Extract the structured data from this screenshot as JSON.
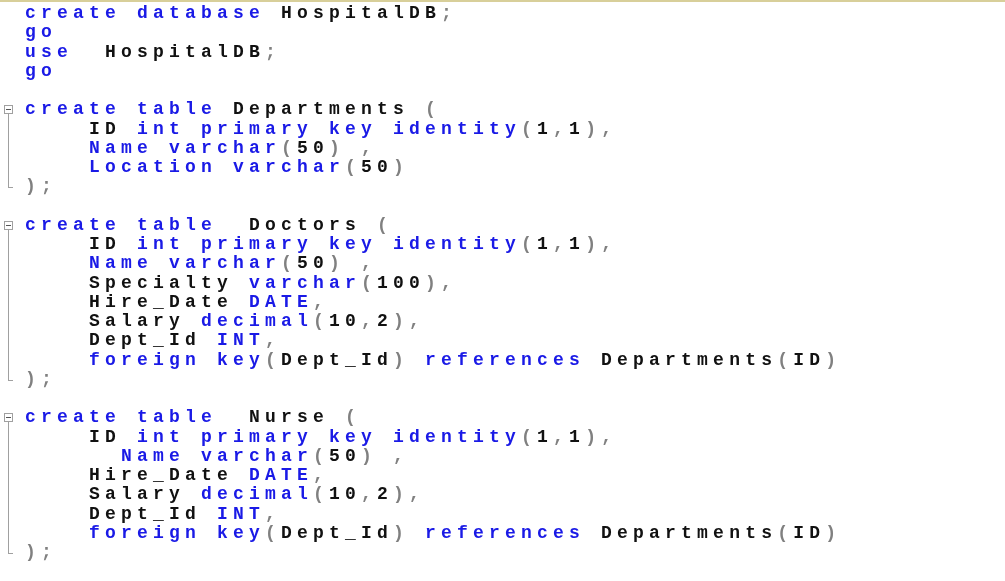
{
  "editor": {
    "lines": [
      {
        "kind": "code",
        "tokens": [
          {
            "text": "create database",
            "kind": "keyword"
          },
          {
            "text": " HospitalDB",
            "kind": "plain"
          },
          {
            "text": ";",
            "kind": "punct"
          }
        ]
      },
      {
        "kind": "code",
        "tokens": [
          {
            "text": "go",
            "kind": "keyword"
          }
        ]
      },
      {
        "kind": "code",
        "tokens": [
          {
            "text": "use",
            "kind": "keyword"
          },
          {
            "text": "  HospitalDB",
            "kind": "plain"
          },
          {
            "text": ";",
            "kind": "punct"
          }
        ]
      },
      {
        "kind": "code",
        "tokens": [
          {
            "text": "go",
            "kind": "keyword"
          }
        ]
      },
      {
        "kind": "blank"
      },
      {
        "kind": "code",
        "expanded": true,
        "tokens": [
          {
            "text": "create table",
            "kind": "keyword"
          },
          {
            "text": " Departments",
            "kind": "plain"
          },
          {
            "text": " (",
            "kind": "punct"
          }
        ],
        "children": [
          {
            "kind": "code",
            "tokens": [
              {
                "text": "    ID",
                "kind": "plain"
              },
              {
                "text": " int primary key identity",
                "kind": "keyword"
              },
              {
                "text": "(",
                "kind": "punct"
              },
              {
                "text": "1",
                "kind": "plain"
              },
              {
                "text": ",",
                "kind": "punct"
              },
              {
                "text": "1",
                "kind": "plain"
              },
              {
                "text": "),",
                "kind": "punct"
              }
            ]
          },
          {
            "kind": "code",
            "tokens": [
              {
                "text": "    Name varchar",
                "kind": "keyword"
              },
              {
                "text": "(",
                "kind": "punct"
              },
              {
                "text": "50",
                "kind": "plain"
              },
              {
                "text": ") ,",
                "kind": "punct"
              }
            ]
          },
          {
            "kind": "code",
            "tokens": [
              {
                "text": "    Location varchar",
                "kind": "keyword"
              },
              {
                "text": "(",
                "kind": "punct"
              },
              {
                "text": "50",
                "kind": "plain"
              },
              {
                "text": ")",
                "kind": "punct"
              }
            ]
          },
          {
            "kind": "code",
            "tokens": [
              {
                "text": ");",
                "kind": "punct"
              }
            ]
          }
        ]
      },
      {
        "kind": "blank"
      },
      {
        "kind": "code",
        "expanded": true,
        "tokens": [
          {
            "text": "create table",
            "kind": "keyword"
          },
          {
            "text": "  Doctors",
            "kind": "plain"
          },
          {
            "text": " (",
            "kind": "punct"
          }
        ],
        "children": [
          {
            "kind": "code",
            "tokens": [
              {
                "text": "    ID",
                "kind": "plain"
              },
              {
                "text": " int primary key identity",
                "kind": "keyword"
              },
              {
                "text": "(",
                "kind": "punct"
              },
              {
                "text": "1",
                "kind": "plain"
              },
              {
                "text": ",",
                "kind": "punct"
              },
              {
                "text": "1",
                "kind": "plain"
              },
              {
                "text": "),",
                "kind": "punct"
              }
            ]
          },
          {
            "kind": "code",
            "tokens": [
              {
                "text": "    Name varchar",
                "kind": "keyword"
              },
              {
                "text": "(",
                "kind": "punct"
              },
              {
                "text": "50",
                "kind": "plain"
              },
              {
                "text": ") ,",
                "kind": "punct"
              }
            ]
          },
          {
            "kind": "code",
            "tokens": [
              {
                "text": "    Specialty",
                "kind": "plain"
              },
              {
                "text": " varchar",
                "kind": "keyword"
              },
              {
                "text": "(",
                "kind": "punct"
              },
              {
                "text": "100",
                "kind": "plain"
              },
              {
                "text": "),",
                "kind": "punct"
              }
            ]
          },
          {
            "kind": "code",
            "tokens": [
              {
                "text": "    Hire_Date",
                "kind": "plain"
              },
              {
                "text": " DATE",
                "kind": "keyword"
              },
              {
                "text": ",",
                "kind": "punct"
              }
            ]
          },
          {
            "kind": "code",
            "tokens": [
              {
                "text": "    Salary",
                "kind": "plain"
              },
              {
                "text": " decimal",
                "kind": "keyword"
              },
              {
                "text": "(",
                "kind": "punct"
              },
              {
                "text": "10",
                "kind": "plain"
              },
              {
                "text": ",",
                "kind": "punct"
              },
              {
                "text": "2",
                "kind": "plain"
              },
              {
                "text": "),",
                "kind": "punct"
              }
            ]
          },
          {
            "kind": "code",
            "tokens": [
              {
                "text": "    Dept_Id",
                "kind": "plain"
              },
              {
                "text": " INT",
                "kind": "keyword"
              },
              {
                "text": ",",
                "kind": "punct"
              }
            ]
          },
          {
            "kind": "code",
            "tokens": [
              {
                "text": "    foreign key",
                "kind": "keyword"
              },
              {
                "text": "(",
                "kind": "punct"
              },
              {
                "text": "Dept_Id",
                "kind": "plain"
              },
              {
                "text": ")",
                "kind": "punct"
              },
              {
                "text": " references",
                "kind": "keyword"
              },
              {
                "text": " Departments",
                "kind": "plain"
              },
              {
                "text": "(",
                "kind": "punct"
              },
              {
                "text": "ID",
                "kind": "plain"
              },
              {
                "text": ")",
                "kind": "punct"
              }
            ]
          },
          {
            "kind": "code",
            "tokens": [
              {
                "text": ");",
                "kind": "punct"
              }
            ]
          }
        ]
      },
      {
        "kind": "blank"
      },
      {
        "kind": "code",
        "expanded": true,
        "tokens": [
          {
            "text": "create table",
            "kind": "keyword"
          },
          {
            "text": "  Nurse",
            "kind": "plain"
          },
          {
            "text": " (",
            "kind": "punct"
          }
        ],
        "children": [
          {
            "kind": "code",
            "tokens": [
              {
                "text": "    ID",
                "kind": "plain"
              },
              {
                "text": " int primary key identity",
                "kind": "keyword"
              },
              {
                "text": "(",
                "kind": "punct"
              },
              {
                "text": "1",
                "kind": "plain"
              },
              {
                "text": ",",
                "kind": "punct"
              },
              {
                "text": "1",
                "kind": "plain"
              },
              {
                "text": "),",
                "kind": "punct"
              }
            ]
          },
          {
            "kind": "code",
            "tokens": [
              {
                "text": "      Name varchar",
                "kind": "keyword"
              },
              {
                "text": "(",
                "kind": "punct"
              },
              {
                "text": "50",
                "kind": "plain"
              },
              {
                "text": ") ,",
                "kind": "punct"
              }
            ]
          },
          {
            "kind": "code",
            "tokens": [
              {
                "text": "    Hire_Date",
                "kind": "plain"
              },
              {
                "text": " DATE",
                "kind": "keyword"
              },
              {
                "text": ",",
                "kind": "punct"
              }
            ]
          },
          {
            "kind": "code",
            "tokens": [
              {
                "text": "    Salary",
                "kind": "plain"
              },
              {
                "text": " decimal",
                "kind": "keyword"
              },
              {
                "text": "(",
                "kind": "punct"
              },
              {
                "text": "10",
                "kind": "plain"
              },
              {
                "text": ",",
                "kind": "punct"
              },
              {
                "text": "2",
                "kind": "plain"
              },
              {
                "text": "),",
                "kind": "punct"
              }
            ]
          },
          {
            "kind": "code",
            "tokens": [
              {
                "text": "    Dept_Id",
                "kind": "plain"
              },
              {
                "text": " INT",
                "kind": "keyword"
              },
              {
                "text": ",",
                "kind": "punct"
              }
            ]
          },
          {
            "kind": "code",
            "tokens": [
              {
                "text": "    foreign key",
                "kind": "keyword"
              },
              {
                "text": "(",
                "kind": "punct"
              },
              {
                "text": "Dept_Id",
                "kind": "plain"
              },
              {
                "text": ")",
                "kind": "punct"
              },
              {
                "text": " references",
                "kind": "keyword"
              },
              {
                "text": " Departments",
                "kind": "plain"
              },
              {
                "text": "(",
                "kind": "punct"
              },
              {
                "text": "ID",
                "kind": "plain"
              },
              {
                "text": ")",
                "kind": "punct"
              }
            ]
          },
          {
            "kind": "code",
            "tokens": [
              {
                "text": ");",
                "kind": "punct"
              }
            ]
          }
        ]
      }
    ]
  }
}
